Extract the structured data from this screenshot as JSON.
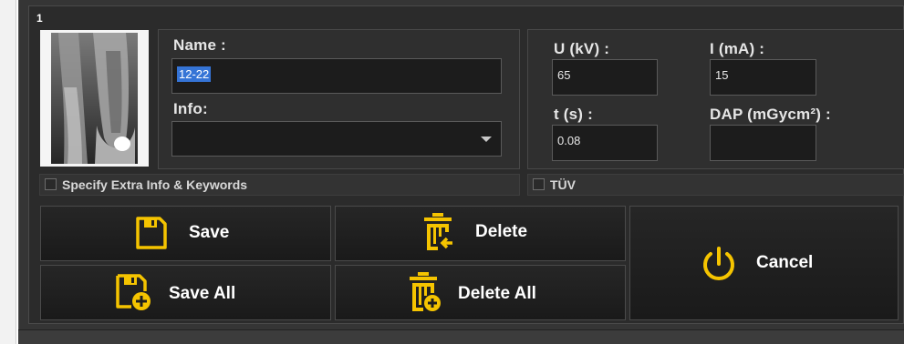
{
  "panel": {
    "number": "1"
  },
  "name_section": {
    "name_label": "Name :",
    "name_value": "12-22",
    "info_label": "Info:",
    "info_value": ""
  },
  "xray": {
    "u_label": "U (kV) :",
    "u_value": "65",
    "i_label": "I (mA) :",
    "i_value": "15",
    "t_label": "t (s) :",
    "t_value": "0.08",
    "dap_label": "DAP (mGycm²) :",
    "dap_value": ""
  },
  "checks": {
    "extra_info_label": "Specify Extra Info & Keywords",
    "tuv_label": "TÜV"
  },
  "buttons": {
    "save": "Save",
    "delete": "Delete",
    "save_all": "Save All",
    "delete_all": "Delete All",
    "cancel": "Cancel"
  },
  "icons": {
    "save": "floppy-disk-icon",
    "save_all": "floppy-disk-plus-icon",
    "delete": "trash-arrow-icon",
    "delete_all": "trash-plus-icon",
    "cancel": "power-icon",
    "accent_color": "#f5c400"
  }
}
